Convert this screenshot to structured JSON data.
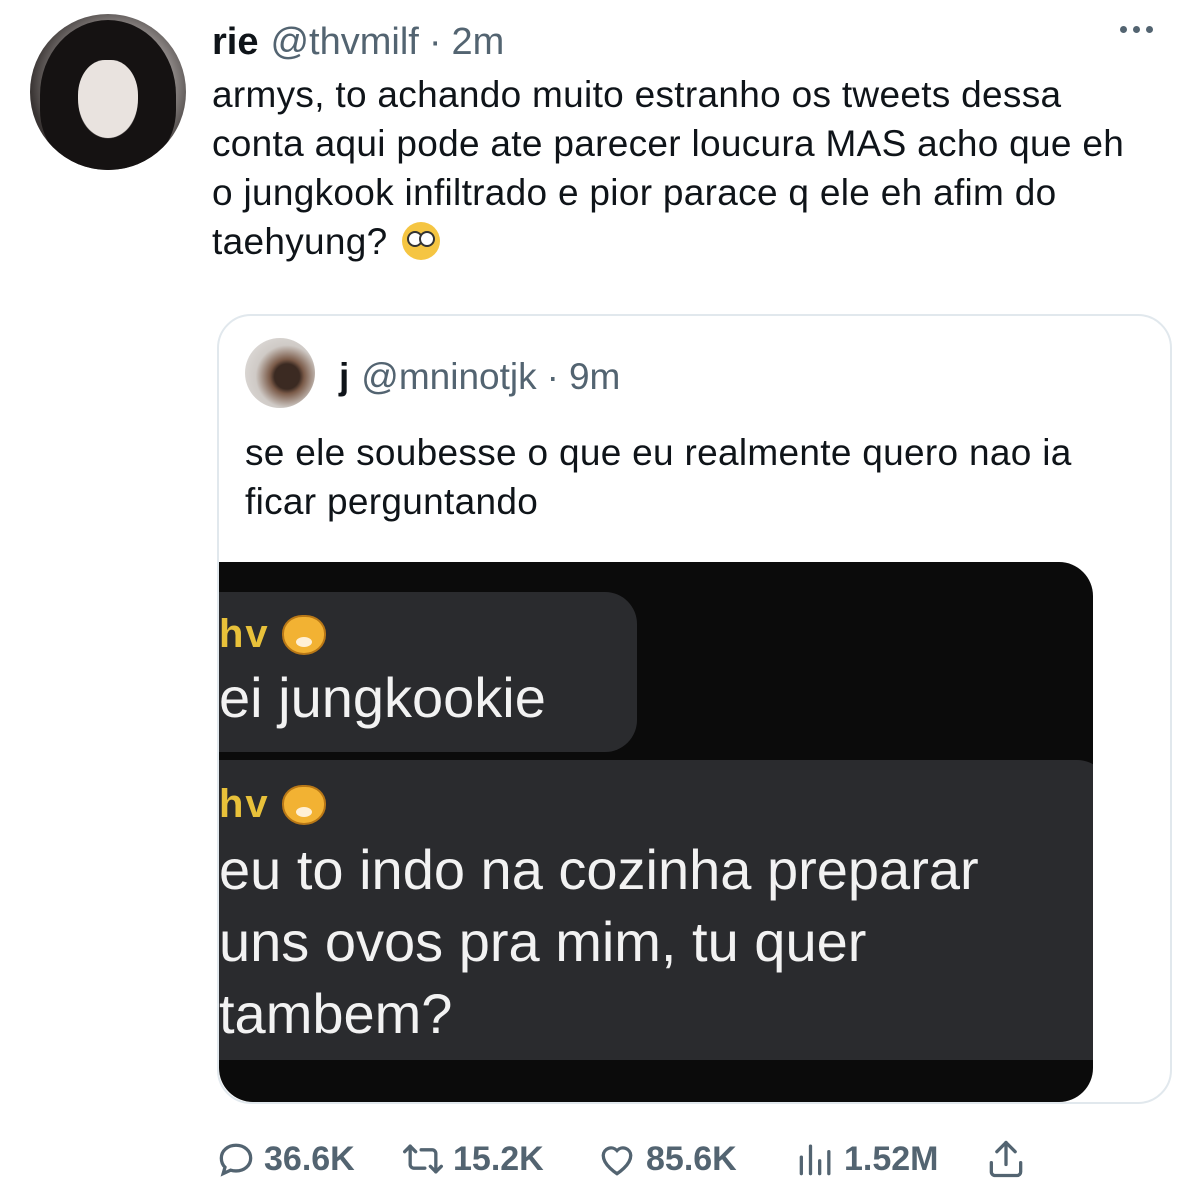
{
  "tweet": {
    "display_name": "rie",
    "handle": "@thvmilf",
    "separator": "·",
    "time": "2m",
    "text": "armys, to achando muito estranho os tweets dessa conta aqui pode ate parecer loucura MAS acho que eh o jungkook infiltrado e pior parace q ele eh afim do taehyung?",
    "trailing_emoji": "flushed-face-emoji"
  },
  "quote": {
    "display_name": "j",
    "handle": "@mninotjk",
    "separator": "·",
    "time": "9m",
    "text": "se ele soubesse o que eu realmente quero nao ia ficar perguntando",
    "media": {
      "messages": [
        {
          "sender": "hv",
          "sender_emoji": "tiger-face-emoji",
          "text": "ei jungkookie"
        },
        {
          "sender": "hv",
          "sender_emoji": "tiger-face-emoji",
          "lines": [
            "eu to indo na cozinha preparar",
            "uns ovos pra mim, tu quer",
            "tambem?"
          ]
        }
      ]
    }
  },
  "actions": {
    "replies": "36.6K",
    "retweets": "15.2K",
    "likes": "85.6K",
    "views": "1.52M"
  },
  "colors": {
    "text": "#0f1419",
    "secondary": "#536471",
    "border": "#e1e8ed",
    "media_bg": "#0b0b0b",
    "bubble": "#2a2b2e",
    "sender": "#e8c13a"
  }
}
